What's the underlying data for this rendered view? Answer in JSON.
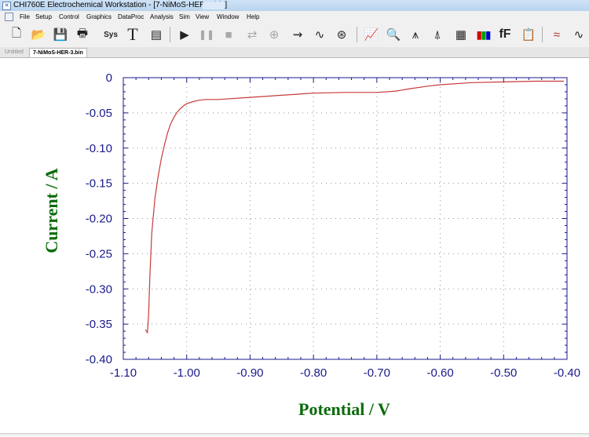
{
  "window": {
    "title": "CHI760E Electrochemical Workstation - [7-NiMoS-HER-3.bin]"
  },
  "menu": {
    "items": [
      "File",
      "Setup",
      "Control",
      "Graphics",
      "DataProc",
      "Analysis",
      "Sim",
      "View",
      "Window",
      "Help"
    ]
  },
  "toolbar": {
    "buttons": [
      {
        "name": "new-file-icon",
        "glyph": "🗋",
        "enabled": true
      },
      {
        "name": "open-folder-icon",
        "glyph": "📂",
        "enabled": true
      },
      {
        "name": "save-disk-icon",
        "glyph": "💾",
        "enabled": true
      },
      {
        "name": "print-icon",
        "glyph": "🖶",
        "enabled": true
      },
      {
        "name": "system-setup-icon",
        "glyph": "Sys",
        "enabled": true
      },
      {
        "name": "technique-icon",
        "glyph": "T",
        "enabled": true
      },
      {
        "name": "parameters-icon",
        "glyph": "▤",
        "enabled": true
      },
      {
        "name": "run-play-icon",
        "glyph": "▶",
        "enabled": true
      },
      {
        "name": "pause-icon",
        "glyph": "❚❚",
        "enabled": false
      },
      {
        "name": "stop-icon",
        "glyph": "■",
        "enabled": false
      },
      {
        "name": "reverse-scan-icon",
        "glyph": "⇄",
        "enabled": false
      },
      {
        "name": "ir-comp-icon",
        "glyph": "⊕",
        "enabled": false
      },
      {
        "name": "filter-icon",
        "glyph": "⇝",
        "enabled": true
      },
      {
        "name": "cell-control-icon",
        "glyph": "∿",
        "enabled": true
      },
      {
        "name": "open-circuit-icon",
        "glyph": "⊛",
        "enabled": true
      },
      {
        "name": "present-data-plot-icon",
        "glyph": "📈",
        "enabled": true
      },
      {
        "name": "zoom-icon",
        "glyph": "🔍",
        "enabled": true
      },
      {
        "name": "peak-icon",
        "glyph": "⩚",
        "enabled": true
      },
      {
        "name": "manual-results-icon",
        "glyph": "⍋",
        "enabled": true
      },
      {
        "name": "graph-options-icon",
        "glyph": "▦",
        "enabled": true
      },
      {
        "name": "color-icon",
        "glyph": "▮▮▮",
        "enabled": true
      },
      {
        "name": "font-icon",
        "glyph": "fF",
        "enabled": true
      },
      {
        "name": "clipboard-icon",
        "glyph": "📋",
        "enabled": true
      },
      {
        "name": "smooth-icon",
        "glyph": "≈",
        "enabled": true
      },
      {
        "name": "derivative-icon",
        "glyph": "∿",
        "enabled": true
      }
    ]
  },
  "tabs": [
    {
      "label": "Untitled",
      "active": false
    },
    {
      "label": "7-NiMoS-HER-3.bin",
      "active": true
    }
  ],
  "colors": {
    "axis_label": "#0a6b0a",
    "tick_label": "#1a1a8c",
    "curve": "#c83a3a",
    "axis": "#1a1a8c",
    "grid": "#9090a0"
  },
  "chart_data": {
    "type": "line",
    "title": "",
    "xlabel": "Potential / V",
    "ylabel": "Current / A",
    "xlim": [
      -1.1,
      -0.4
    ],
    "ylim": [
      -0.4,
      0
    ],
    "x_ticks": [
      "-1.10",
      "-1.00",
      "-0.90",
      "-0.80",
      "-0.70",
      "-0.60",
      "-0.50",
      "-0.40"
    ],
    "y_ticks": [
      "0",
      "-0.05",
      "-0.10",
      "-0.15",
      "-0.20",
      "-0.25",
      "-0.30",
      "-0.35",
      "-0.40"
    ],
    "x_tick_values": [
      -1.1,
      -1.0,
      -0.9,
      -0.8,
      -0.7,
      -0.6,
      -0.5,
      -0.4
    ],
    "y_tick_values": [
      0,
      -0.05,
      -0.1,
      -0.15,
      -0.2,
      -0.25,
      -0.3,
      -0.35,
      -0.4
    ],
    "grid": true,
    "series": [
      {
        "x": [
          -1.065,
          -1.062,
          -1.06,
          -1.058,
          -1.055,
          -1.05,
          -1.045,
          -1.04,
          -1.035,
          -1.03,
          -1.025,
          -1.02,
          -1.015,
          -1.01,
          -1.005,
          -1.0,
          -0.99,
          -0.98,
          -0.97,
          -0.95,
          -0.9,
          -0.85,
          -0.8,
          -0.75,
          -0.7,
          -0.67,
          -0.65,
          -0.62,
          -0.6,
          -0.55,
          -0.5,
          -0.45,
          -0.405
        ],
        "y": [
          -0.358,
          -0.362,
          -0.335,
          -0.28,
          -0.22,
          -0.17,
          -0.14,
          -0.115,
          -0.095,
          -0.078,
          -0.065,
          -0.056,
          -0.049,
          -0.044,
          -0.04,
          -0.037,
          -0.034,
          -0.032,
          -0.031,
          -0.031,
          -0.028,
          -0.025,
          -0.022,
          -0.021,
          -0.021,
          -0.019,
          -0.016,
          -0.012,
          -0.01,
          -0.007,
          -0.006,
          -0.005,
          -0.005
        ]
      }
    ]
  }
}
